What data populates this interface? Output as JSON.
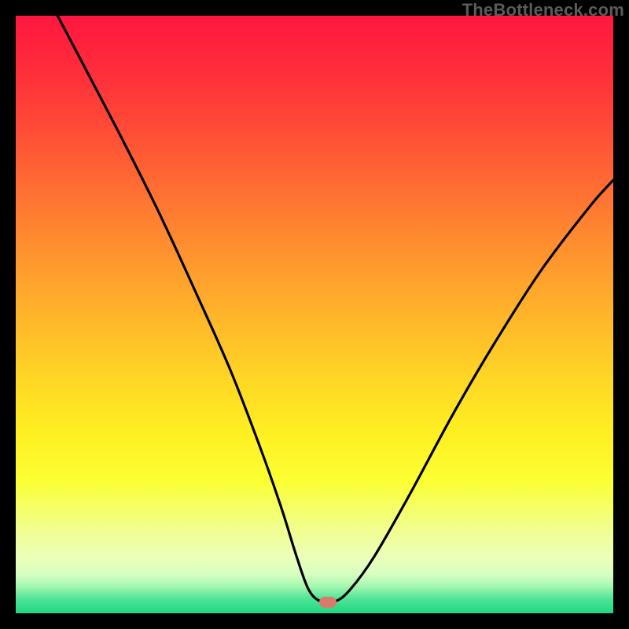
{
  "watermark": "TheBottleneck.com",
  "marker": {
    "color": "#d97b6c",
    "x_pct": 52.2,
    "y_pct": 98.1
  },
  "gradient_stops": [
    {
      "offset": 0.0,
      "color": "#ff173f"
    },
    {
      "offset": 0.1,
      "color": "#ff2f3a"
    },
    {
      "offset": 0.22,
      "color": "#ff5635"
    },
    {
      "offset": 0.35,
      "color": "#ff8330"
    },
    {
      "offset": 0.48,
      "color": "#ffae2b"
    },
    {
      "offset": 0.6,
      "color": "#ffd426"
    },
    {
      "offset": 0.7,
      "color": "#fff022"
    },
    {
      "offset": 0.78,
      "color": "#fbff33"
    },
    {
      "offset": 0.85,
      "color": "#f2ff85"
    },
    {
      "offset": 0.905,
      "color": "#ecffb9"
    },
    {
      "offset": 0.935,
      "color": "#d7ffc1"
    },
    {
      "offset": 0.955,
      "color": "#a4f7b0"
    },
    {
      "offset": 0.975,
      "color": "#52e598"
    },
    {
      "offset": 1.0,
      "color": "#19d882"
    }
  ],
  "chart_data": {
    "type": "line",
    "title": "",
    "xlabel": "",
    "ylabel": "",
    "xlim": [
      0,
      100
    ],
    "ylim": [
      0,
      100
    ],
    "note": "Axis ticks and numeric labels are not rendered in the image; values are normalized percentages of plot width/height. y is read with 0 at bottom (best) and 100 at top (worst).",
    "series": [
      {
        "name": "bottleneck-curve",
        "x": [
          7.0,
          12.0,
          18.0,
          24.0,
          30.0,
          36.0,
          41.0,
          44.5,
          47.0,
          49.0,
          51.0,
          53.5,
          56.0,
          60.0,
          66.0,
          73.0,
          80.0,
          88.0,
          96.0,
          100.0
        ],
        "y": [
          100.0,
          90.5,
          79.0,
          67.0,
          54.0,
          40.5,
          27.5,
          17.5,
          9.5,
          4.0,
          2.0,
          2.0,
          4.0,
          9.5,
          20.0,
          33.0,
          45.0,
          57.5,
          68.0,
          72.5
        ]
      }
    ],
    "optimum_marker": {
      "x": 52.2,
      "y": 1.9
    }
  }
}
